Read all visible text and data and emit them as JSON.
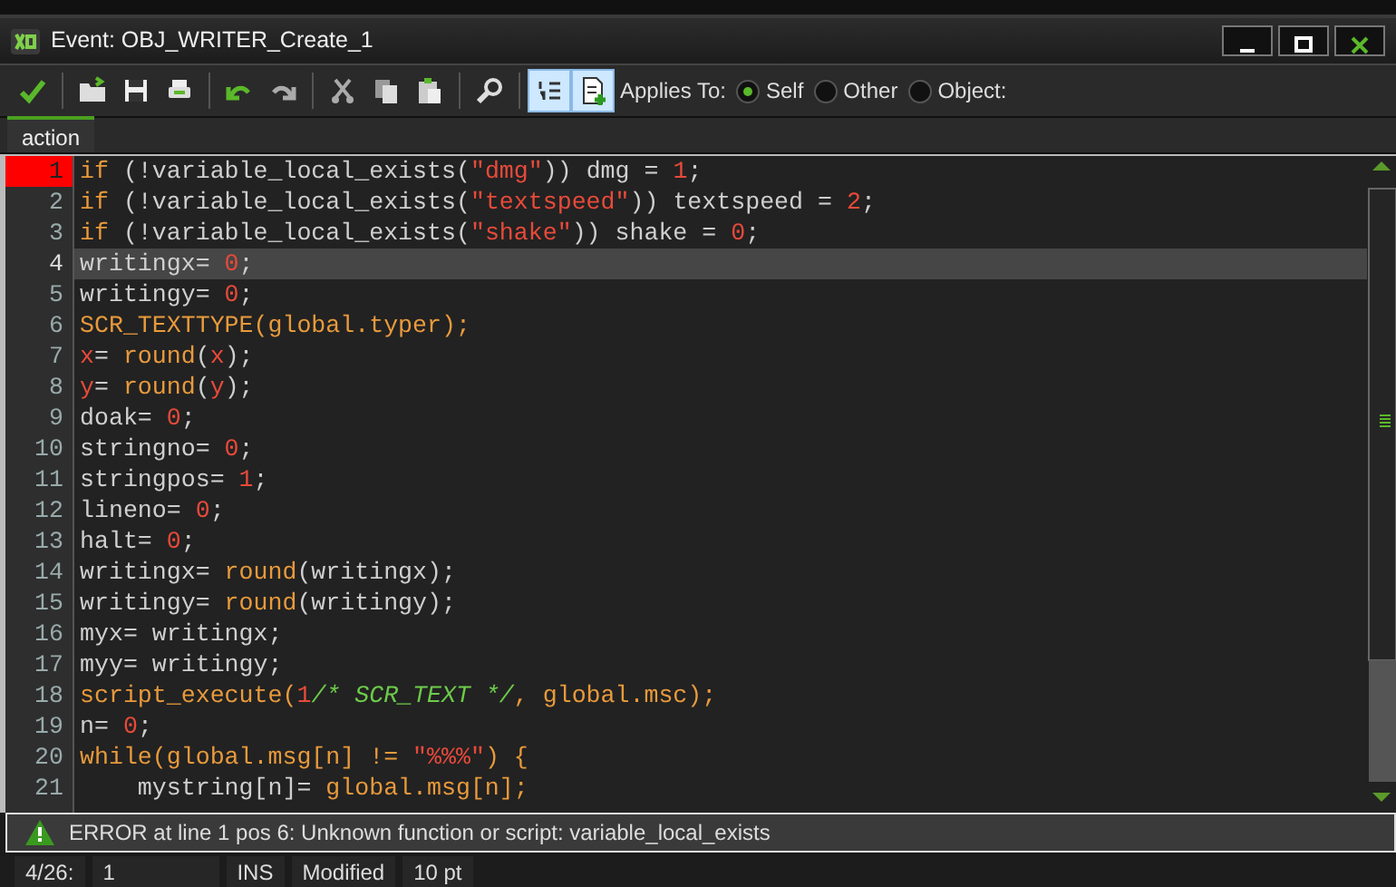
{
  "window": {
    "title": "Event: OBJ_WRITER_Create_1"
  },
  "toolbar": {
    "buttons": [
      {
        "kind": "check",
        "active": false
      },
      {
        "kind": "folder",
        "active": false
      },
      {
        "kind": "save",
        "active": false
      },
      {
        "kind": "print",
        "active": false
      },
      {
        "kind": "undo",
        "active": false
      },
      {
        "kind": "redo",
        "active": false
      },
      {
        "kind": "cut",
        "active": false
      },
      {
        "kind": "copy",
        "active": false
      },
      {
        "kind": "paste",
        "active": false
      },
      {
        "kind": "search",
        "active": false
      },
      {
        "kind": "linenumbers",
        "active": true
      },
      {
        "kind": "docadd",
        "active": true
      }
    ],
    "applies_label": "Applies To:",
    "applies": [
      {
        "label": "Self",
        "selected": true
      },
      {
        "label": "Other",
        "selected": false
      },
      {
        "label": "Object:",
        "selected": false
      }
    ]
  },
  "tabs": [
    {
      "label": "action",
      "selected": true
    }
  ],
  "code": [
    {
      "number": "1",
      "selected": false,
      "error": true,
      "tokens": [
        {
          "kind": "kw",
          "t": "if"
        },
        {
          "kind": "plain",
          "t": " (!variable_local_exists("
        },
        {
          "kind": "str",
          "t": "\"dmg\""
        },
        {
          "kind": "plain",
          "t": ")) dmg = "
        },
        {
          "kind": "num",
          "t": "1"
        },
        {
          "kind": "plain",
          "t": ";"
        }
      ]
    },
    {
      "number": "2",
      "selected": false,
      "error": false,
      "tokens": [
        {
          "kind": "kw",
          "t": "if"
        },
        {
          "kind": "plain",
          "t": " (!variable_local_exists("
        },
        {
          "kind": "str",
          "t": "\"textspeed\""
        },
        {
          "kind": "plain",
          "t": ")) textspeed = "
        },
        {
          "kind": "num",
          "t": "2"
        },
        {
          "kind": "plain",
          "t": ";"
        }
      ]
    },
    {
      "number": "3",
      "selected": false,
      "error": false,
      "tokens": [
        {
          "kind": "kw",
          "t": "if"
        },
        {
          "kind": "plain",
          "t": " (!variable_local_exists("
        },
        {
          "kind": "str",
          "t": "\"shake\""
        },
        {
          "kind": "plain",
          "t": ")) shake = "
        },
        {
          "kind": "num",
          "t": "0"
        },
        {
          "kind": "plain",
          "t": ";"
        }
      ]
    },
    {
      "number": "4",
      "selected": true,
      "error": false,
      "tokens": [
        {
          "kind": "plain",
          "t": "writingx= "
        },
        {
          "kind": "num",
          "t": "0"
        },
        {
          "kind": "plain",
          "t": ";"
        }
      ]
    },
    {
      "number": "5",
      "selected": false,
      "error": false,
      "tokens": [
        {
          "kind": "plain",
          "t": "writingy= "
        },
        {
          "kind": "num",
          "t": "0"
        },
        {
          "kind": "plain",
          "t": ";"
        }
      ]
    },
    {
      "number": "6",
      "selected": false,
      "error": false,
      "tokens": [
        {
          "kind": "fn",
          "t": "SCR_TEXTTYPE(global.typer);"
        }
      ]
    },
    {
      "number": "7",
      "selected": false,
      "error": false,
      "tokens": [
        {
          "kind": "num",
          "t": "x"
        },
        {
          "kind": "plain",
          "t": "= "
        },
        {
          "kind": "fn",
          "t": "round"
        },
        {
          "kind": "plain",
          "t": "("
        },
        {
          "kind": "num",
          "t": "x"
        },
        {
          "kind": "plain",
          "t": ");"
        }
      ]
    },
    {
      "number": "8",
      "selected": false,
      "error": false,
      "tokens": [
        {
          "kind": "num",
          "t": "y"
        },
        {
          "kind": "plain",
          "t": "= "
        },
        {
          "kind": "fn",
          "t": "round"
        },
        {
          "kind": "plain",
          "t": "("
        },
        {
          "kind": "num",
          "t": "y"
        },
        {
          "kind": "plain",
          "t": ");"
        }
      ]
    },
    {
      "number": "9",
      "selected": false,
      "error": false,
      "tokens": [
        {
          "kind": "plain",
          "t": "doak= "
        },
        {
          "kind": "num",
          "t": "0"
        },
        {
          "kind": "plain",
          "t": ";"
        }
      ]
    },
    {
      "number": "10",
      "selected": false,
      "error": false,
      "tokens": [
        {
          "kind": "plain",
          "t": "stringno= "
        },
        {
          "kind": "num",
          "t": "0"
        },
        {
          "kind": "plain",
          "t": ";"
        }
      ]
    },
    {
      "number": "11",
      "selected": false,
      "error": false,
      "tokens": [
        {
          "kind": "plain",
          "t": "stringpos= "
        },
        {
          "kind": "num",
          "t": "1"
        },
        {
          "kind": "plain",
          "t": ";"
        }
      ]
    },
    {
      "number": "12",
      "selected": false,
      "error": false,
      "tokens": [
        {
          "kind": "plain",
          "t": "lineno= "
        },
        {
          "kind": "num",
          "t": "0"
        },
        {
          "kind": "plain",
          "t": ";"
        }
      ]
    },
    {
      "number": "13",
      "selected": false,
      "error": false,
      "tokens": [
        {
          "kind": "plain",
          "t": "halt= "
        },
        {
          "kind": "num",
          "t": "0"
        },
        {
          "kind": "plain",
          "t": ";"
        }
      ]
    },
    {
      "number": "14",
      "selected": false,
      "error": false,
      "tokens": [
        {
          "kind": "plain",
          "t": "writingx= "
        },
        {
          "kind": "fn",
          "t": "round"
        },
        {
          "kind": "plain",
          "t": "(writingx);"
        }
      ]
    },
    {
      "number": "15",
      "selected": false,
      "error": false,
      "tokens": [
        {
          "kind": "plain",
          "t": "writingy= "
        },
        {
          "kind": "fn",
          "t": "round"
        },
        {
          "kind": "plain",
          "t": "(writingy);"
        }
      ]
    },
    {
      "number": "16",
      "selected": false,
      "error": false,
      "tokens": [
        {
          "kind": "plain",
          "t": "myx= writingx;"
        }
      ]
    },
    {
      "number": "17",
      "selected": false,
      "error": false,
      "tokens": [
        {
          "kind": "plain",
          "t": "myy= writingy;"
        }
      ]
    },
    {
      "number": "18",
      "selected": false,
      "error": false,
      "tokens": [
        {
          "kind": "fn",
          "t": "script_execute("
        },
        {
          "kind": "num",
          "t": "1"
        },
        {
          "kind": "cm",
          "t": "/* SCR_TEXT */"
        },
        {
          "kind": "fn",
          "t": ", global.msc);"
        }
      ]
    },
    {
      "number": "19",
      "selected": false,
      "error": false,
      "tokens": [
        {
          "kind": "plain",
          "t": "n= "
        },
        {
          "kind": "num",
          "t": "0"
        },
        {
          "kind": "plain",
          "t": ";"
        }
      ]
    },
    {
      "number": "20",
      "selected": false,
      "error": false,
      "tokens": [
        {
          "kind": "fn",
          "t": "while(global.msg[n] != "
        },
        {
          "kind": "str",
          "t": "\"%%%\""
        },
        {
          "kind": "fn",
          "t": ") {"
        }
      ]
    },
    {
      "number": "21",
      "selected": false,
      "error": false,
      "tokens": [
        {
          "kind": "plain",
          "t": "    mystring[n]= "
        },
        {
          "kind": "fn",
          "t": "global.msg[n];"
        }
      ]
    }
  ],
  "error_bar": {
    "message": "ERROR at line 1 pos 6: Unknown function or script: variable_local_exists"
  },
  "status_bar": [
    "4/26:",
    "1",
    "INS",
    "Modified",
    "10 pt"
  ]
}
